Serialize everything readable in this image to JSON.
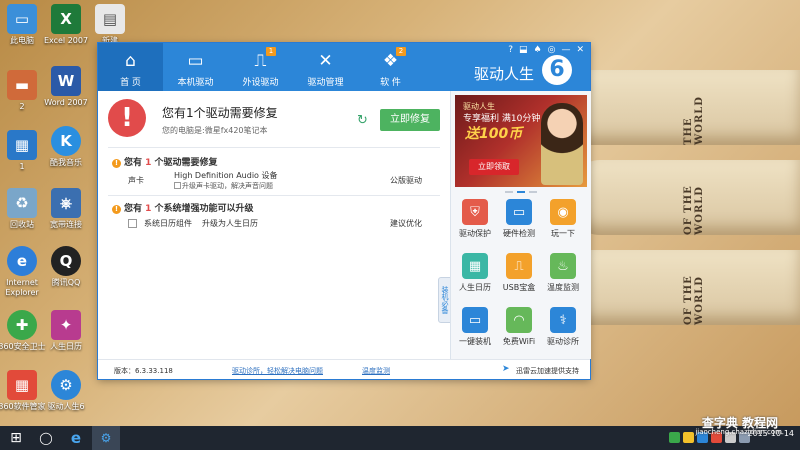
{
  "desktop": {
    "icons": [
      {
        "label": "此电脑",
        "symbol": "▭",
        "color": "#3b8fd9"
      },
      {
        "label": "Excel 2007",
        "symbol": "X",
        "color": "#1f7a3a"
      },
      {
        "label": "新建",
        "symbol": "▤",
        "color": "#e8e8e8"
      },
      {
        "label": "2",
        "symbol": "▬",
        "color": "#d06a3a"
      },
      {
        "label": "Word 2007",
        "symbol": "W",
        "color": "#2b5aa8"
      },
      {
        "label": "1",
        "symbol": "▦",
        "color": "#2a78c8"
      },
      {
        "label": "酷我音乐",
        "symbol": "K",
        "color": "#2a8fe0"
      },
      {
        "label": "回收站",
        "symbol": "♻",
        "color": "#7aa6c9"
      },
      {
        "label": "宽带连接",
        "symbol": "⎈",
        "color": "#3b6fb0"
      },
      {
        "label": "Internet Explorer",
        "symbol": "e",
        "color": "#2d7ed9"
      },
      {
        "label": "腾讯QQ",
        "symbol": "Q",
        "color": "#222222"
      },
      {
        "label": "360安全卫士",
        "symbol": "✚",
        "color": "#3aa84a"
      },
      {
        "label": "人生日历",
        "symbol": "✦",
        "color": "#b83b8f"
      },
      {
        "label": "360软件管家",
        "symbol": "▦",
        "color": "#e24a3a"
      },
      {
        "label": "驱动人生6",
        "symbol": "⚙",
        "color": "#2c86d8"
      }
    ],
    "books": [
      "THE WORLD",
      "OF THE WORLD",
      "OF THE WORLD"
    ]
  },
  "taskbar": {
    "start_icon": "⊞",
    "search_icon": "◯",
    "ie_icon": "e",
    "app_icon": "⚙",
    "clock_time": "",
    "clock_date": "2015-10-14"
  },
  "app": {
    "title": "驱动人生",
    "logo": "6",
    "nav": [
      {
        "label": "首 页",
        "icon": "⌂",
        "badge": ""
      },
      {
        "label": "本机驱动",
        "icon": "▭",
        "badge": ""
      },
      {
        "label": "外设驱动",
        "icon": "⎍",
        "badge": "1"
      },
      {
        "label": "驱动管理",
        "icon": "✕",
        "badge": ""
      },
      {
        "label": "软 件",
        "icon": "❖",
        "badge": "2"
      }
    ],
    "window_controls": [
      "?",
      "⬓",
      "♠",
      "◎",
      "—",
      "✕"
    ],
    "headline": "您有1个驱动需要修复",
    "subline": "您的电脑是:微星fx420笔记本",
    "fix_button": "立即修复",
    "section1": {
      "title_prefix": "您有 ",
      "count": "1",
      "title_suffix": " 个驱动需要修复",
      "category": "声卡",
      "device": "High Definition Audio 设备",
      "detail": "升级声卡驱动，解决声音问题",
      "tag": "公版驱动"
    },
    "section2": {
      "title_prefix": "您有 ",
      "count": "1",
      "title_suffix": " 个系统增强功能可以升级",
      "item": "系统日历组件",
      "item_detail": "升级为人生日历",
      "tag": "建议优化"
    },
    "side_tab": "装机必备",
    "banner": {
      "line1": "驱动人生",
      "line2": "专享福利 满10分钟",
      "line3": "送100币",
      "cta": "立即领取"
    },
    "tools": [
      {
        "label": "驱动保护",
        "icon": "⛨",
        "color": "#e45b4a"
      },
      {
        "label": "硬件检测",
        "icon": "▭",
        "color": "#2c86d8"
      },
      {
        "label": "玩一下",
        "icon": "◉",
        "color": "#f3a12b"
      },
      {
        "label": "人生日历",
        "icon": "▦",
        "color": "#3bb7a5"
      },
      {
        "label": "USB宝盒",
        "icon": "⎍",
        "color": "#f3a12b"
      },
      {
        "label": "温度监测",
        "icon": "♨",
        "color": "#66b85a"
      },
      {
        "label": "一键装机",
        "icon": "▭",
        "color": "#2c86d8"
      },
      {
        "label": "免费WiFi",
        "icon": "◠",
        "color": "#66b85a"
      },
      {
        "label": "驱动诊所",
        "icon": "⚕",
        "color": "#2c86d8"
      }
    ],
    "footer": {
      "version": "版本：6.3.33.118",
      "diagnose": "驱动诊所，轻松解决电脑问题",
      "temp": "温度监测",
      "support": "迅雷云加速提供支持"
    }
  },
  "watermark": {
    "main": "查字典 教程网",
    "sub": "jiaocheng.chazidian.com"
  }
}
